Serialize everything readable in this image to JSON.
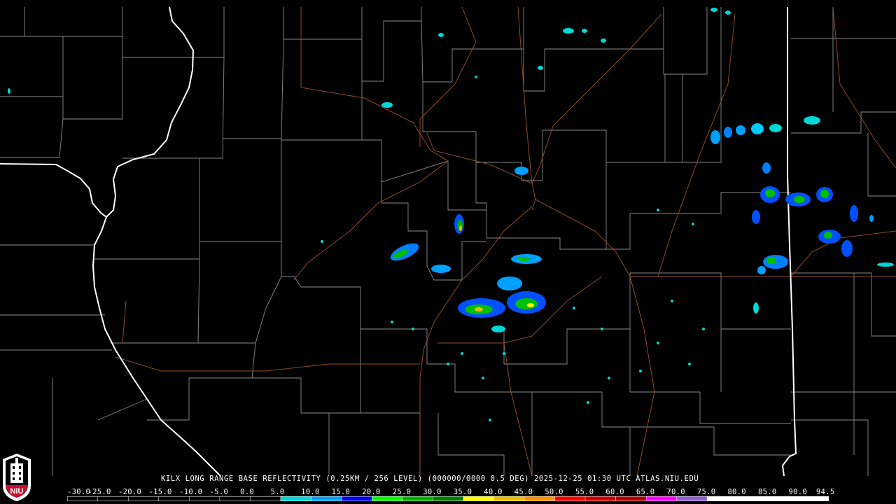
{
  "product_label": "KILX LONG RANGE BASE REFLECTIVITY (0.25KM / 256 LEVEL) (000000/0000 0.5 DEG) 2025-12-25 01:30 UTC  ATLAS.NIU.EDU",
  "legend": {
    "labels": [
      "-30.0",
      "-25.0",
      "-20.0",
      "-15.0",
      "-10.0",
      "-5.0",
      "0.0",
      "5.0",
      "10.0",
      "15.0",
      "20.0",
      "25.0",
      "30.0",
      "35.0",
      "40.0",
      "45.0",
      "50.0",
      "55.0",
      "60.0",
      "65.0",
      "70.0",
      "75.0",
      "80.0",
      "85.0",
      "90.0",
      "94.5"
    ],
    "colors": [
      "#000000",
      "#000000",
      "#000000",
      "#000000",
      "#000000",
      "#000000",
      "#000000",
      "#00d8d8",
      "#00a0ff",
      "#0000ff",
      "#00ff00",
      "#00b000",
      "#008000",
      "#ffff00",
      "#e8c000",
      "#ff9000",
      "#ff0000",
      "#d00000",
      "#b00000",
      "#ff00ff",
      "#9060d0",
      "#ffffff",
      "#ffffff",
      "#ffffff",
      "#ffffff"
    ]
  },
  "logo": {
    "text": "NIU",
    "primary_color": "#c8102e"
  },
  "map_colors": {
    "background": "#000000",
    "county_lines": "#8a8a8a",
    "state_lines": "#ffffff",
    "highways": "#a0522d"
  }
}
